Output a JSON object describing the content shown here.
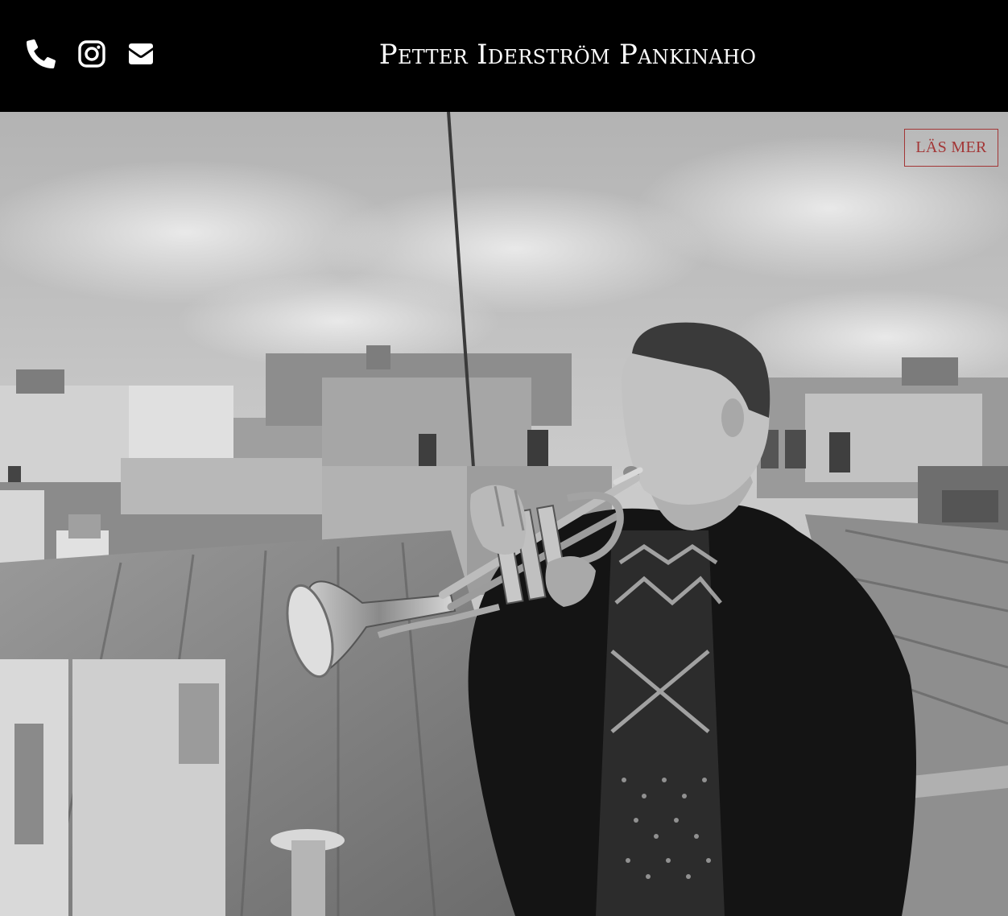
{
  "header": {
    "site_title": "Petter Iderström Pankinaho",
    "icons": [
      "phone-icon",
      "instagram-icon",
      "mail-icon"
    ]
  },
  "hero": {
    "read_more_label": "LÄS MER",
    "photo": "black-and-white photo of a man playing trumpet on a Paris rooftop"
  },
  "colors": {
    "header_bg": "#000000",
    "title_text": "#ffffff",
    "icons": "#ffffff",
    "read_more_accent": "#a33636"
  }
}
